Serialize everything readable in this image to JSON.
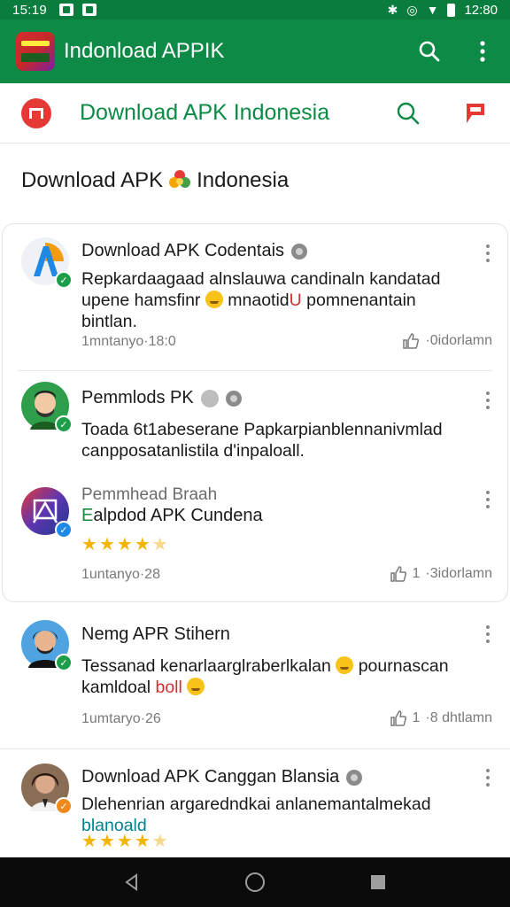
{
  "statusbar": {
    "time": "15:19",
    "clock_right": "12:80"
  },
  "appbar": {
    "title": "Indonload APPIK"
  },
  "site_header": {
    "title": "Download APK Indonesia"
  },
  "page_heading": {
    "left": "Download APK",
    "right": "Indonesia"
  },
  "posts": [
    {
      "name": "Download APK Codentais",
      "text_a": "Repkardaagaad alnslauwa candinaln kandatad upene hamsfinr",
      "text_b": "mnaotid",
      "text_b_red": "U",
      "text_c": "pomnenantain bintlan.",
      "time": "1mntanyo·18:0",
      "meta": "·0idorlamn"
    },
    {
      "name": "Pemmlods PK",
      "text": "Toada 6t1abeserane Papkarpianblennanivmlad canpposatanlistila d'inpaloall.",
      "time": "",
      "meta": ""
    },
    {
      "sub": "Pemmhead Braah",
      "name": "Ealpdod APK Cundena",
      "name_green": "E",
      "name_rest": "alpdod APK Cundena",
      "rating": 4,
      "time": "1untanyo·28",
      "count": "1",
      "meta": "·3idorlamn"
    },
    {
      "name": "Nemg APR Stihern",
      "text_a": "Tessanad kenarlaarglraberlkalan",
      "text_b": "pournascan kamldoal",
      "text_b_red": "boll",
      "time": "1umtaryo·26",
      "count": "1",
      "meta": "·8 dhtlamn"
    },
    {
      "name": "Download APK Canggan Blansia",
      "text": "Dlehenrian argaredndkai anlanemantalmekad",
      "text_teal": "blanoald",
      "rating": 4
    }
  ],
  "colors": {
    "primary_green": "#0d8a45",
    "status_green": "#0a7d3e",
    "star": "#f4b400",
    "accent_red": "#e53935"
  }
}
